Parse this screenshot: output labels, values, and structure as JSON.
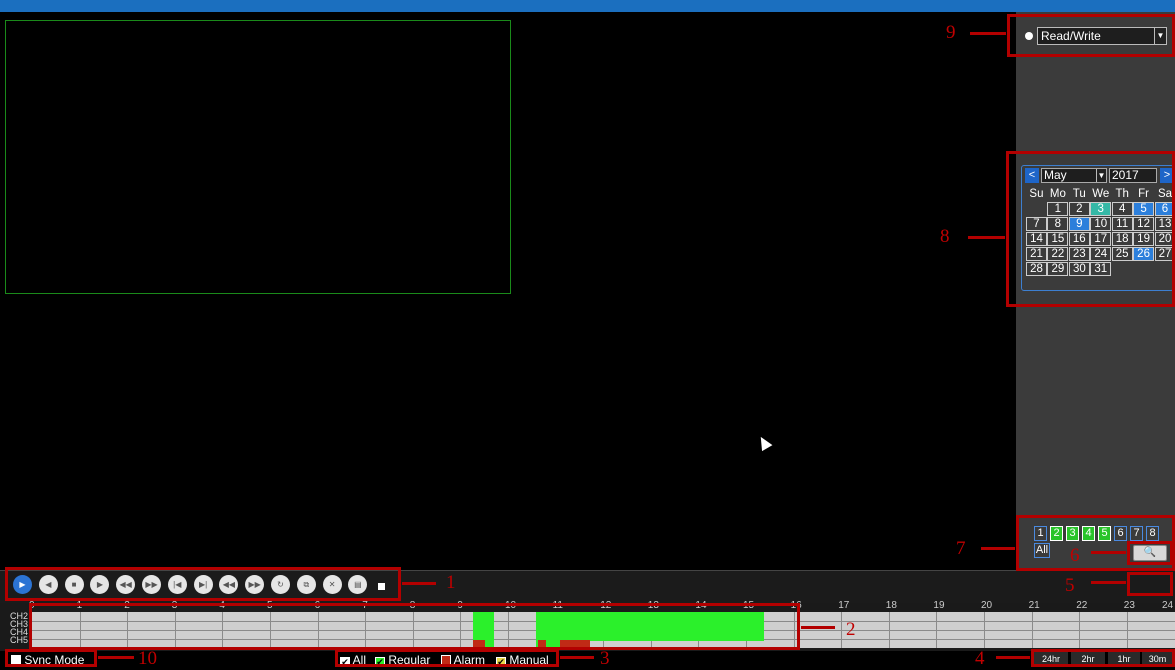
{
  "read_write": {
    "mode": "Read/Write"
  },
  "calendar": {
    "month": "May",
    "year": "2017",
    "prev": "<",
    "next": ">",
    "weekdays": [
      "Su",
      "Mo",
      "Tu",
      "We",
      "Th",
      "Fr",
      "Sa"
    ],
    "weeks": [
      [
        "",
        "1",
        "2",
        "3",
        "4",
        "5",
        "6"
      ],
      [
        "7",
        "8",
        "9",
        "10",
        "11",
        "12",
        "13"
      ],
      [
        "14",
        "15",
        "16",
        "17",
        "18",
        "19",
        "20"
      ],
      [
        "21",
        "22",
        "23",
        "24",
        "25",
        "26",
        "27"
      ],
      [
        "28",
        "29",
        "30",
        "31",
        "",
        "",
        ""
      ]
    ],
    "boxed_days": [
      "1",
      "2",
      "3",
      "4",
      "5",
      "6",
      "7",
      "8",
      "9",
      "10",
      "11",
      "12",
      "13",
      "14",
      "15",
      "16",
      "17",
      "18",
      "19",
      "20",
      "21",
      "22",
      "23",
      "24",
      "25",
      "26",
      "27",
      "28",
      "29",
      "30",
      "31"
    ],
    "highlighted_days": [
      "5",
      "6",
      "9",
      "26"
    ],
    "highlighted_green_days": [
      "3"
    ]
  },
  "channels": {
    "buttons": [
      "1",
      "2",
      "3",
      "4",
      "5",
      "6",
      "7",
      "8"
    ],
    "active": [
      "2",
      "3",
      "4",
      "5"
    ],
    "all_label": "All"
  },
  "search_button": "🔍",
  "sync_button": "⇄",
  "timeline": {
    "hours": [
      "0",
      "1",
      "2",
      "3",
      "4",
      "5",
      "6",
      "7",
      "8",
      "9",
      "10",
      "11",
      "12",
      "13",
      "14",
      "15",
      "16",
      "17",
      "18",
      "19",
      "20",
      "21",
      "22",
      "23",
      "24"
    ],
    "channel_labels": [
      "CH2",
      "CH3",
      "CH4",
      "CH5"
    ]
  },
  "legend": {
    "all": "All",
    "regular": "Regular",
    "alarm": "Alarm",
    "manual": "Manual"
  },
  "sync_mode": "Sync Mode",
  "zoom": [
    "24hr",
    "2hr",
    "1hr",
    "30m"
  ],
  "annotations": [
    "1",
    "2",
    "3",
    "4",
    "5",
    "6",
    "7",
    "8",
    "9",
    "10"
  ],
  "colors": {
    "accent": "#1b6fbf",
    "annotation": "#b30000",
    "regular": "#2bf02b",
    "alarm": "#c02a16",
    "manual": "#e7d84a"
  }
}
